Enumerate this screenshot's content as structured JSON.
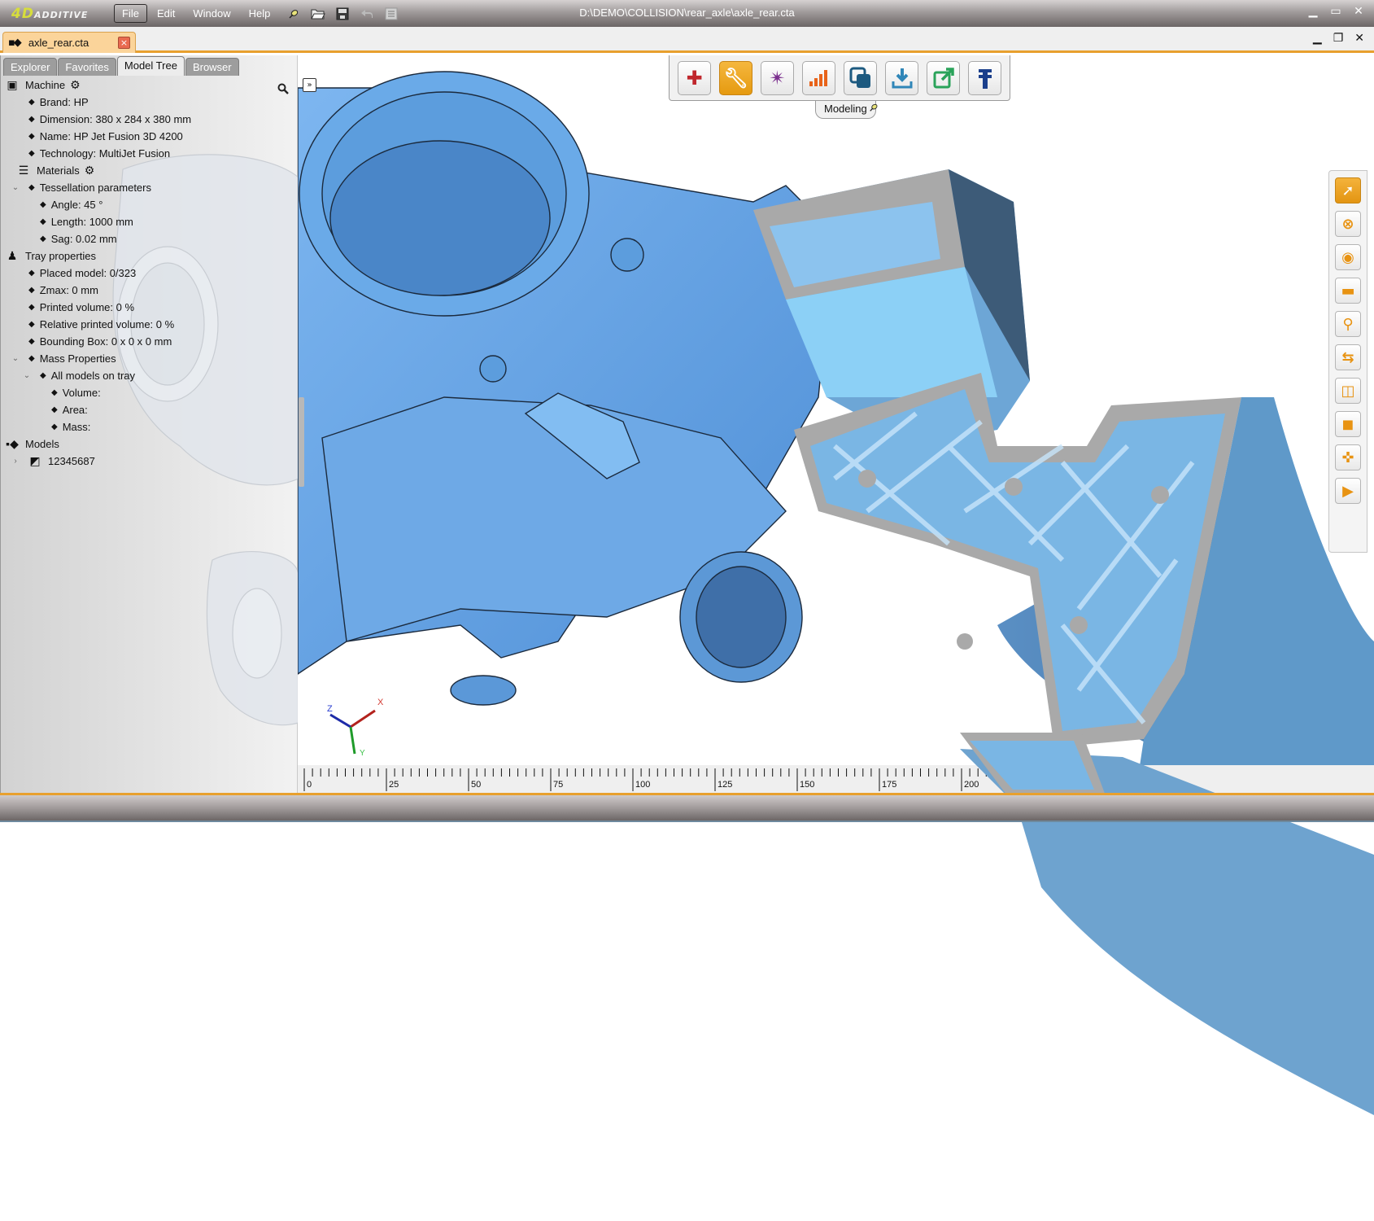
{
  "app": {
    "logo_primary": "4D",
    "logo_secondary": "ADDITIVE",
    "title": "D:\\DEMO\\COLLISION\\rear_axle\\axle_rear.cta",
    "menu": [
      {
        "label": "File",
        "active": true
      },
      {
        "label": "Edit"
      },
      {
        "label": "Window"
      },
      {
        "label": "Help"
      }
    ],
    "quick_icons": [
      "pin-icon",
      "open-folder-icon",
      "save-icon",
      "undo-icon",
      "list-icon"
    ],
    "window_controls": [
      "minimize",
      "maximize",
      "close"
    ]
  },
  "document": {
    "tab_label": "axle_rear.cta",
    "tab_close": "×",
    "controls": [
      "minimize",
      "restore",
      "close"
    ]
  },
  "panel": {
    "tabs": [
      {
        "label": "Explorer"
      },
      {
        "label": "Favorites"
      },
      {
        "label": "Model Tree",
        "active": true
      },
      {
        "label": "Browser"
      }
    ],
    "tree": [
      {
        "label": "Machine",
        "level": 0,
        "icon": "machine-icon",
        "gear": true
      },
      {
        "label": "Brand: HP",
        "level": 1,
        "icon": "bullet"
      },
      {
        "label": "Dimension: 380 x 284 x 380 mm",
        "level": 1,
        "icon": "bullet"
      },
      {
        "label": "Name: HP Jet Fusion 3D 4200",
        "level": 1,
        "icon": "bullet"
      },
      {
        "label": "Technology: MultiJet Fusion",
        "level": 1,
        "icon": "bullet"
      },
      {
        "label": "Materials",
        "level": 1,
        "icon": "database-icon",
        "gear": true
      },
      {
        "label": "Tessellation parameters",
        "level": 1,
        "icon": "bullet",
        "expanded": true
      },
      {
        "label": "Angle: 45 °",
        "level": 2,
        "icon": "bullet"
      },
      {
        "label": "Length: 1000 mm",
        "level": 2,
        "icon": "bullet"
      },
      {
        "label": "Sag: 0.02 mm",
        "level": 2,
        "icon": "bullet"
      },
      {
        "label": "Tray properties",
        "level": 0,
        "icon": "tray-icon"
      },
      {
        "label": "Placed model: 0/323",
        "level": 1,
        "icon": "bullet"
      },
      {
        "label": "Zmax: 0 mm",
        "level": 1,
        "icon": "bullet"
      },
      {
        "label": "Printed volume: 0 %",
        "level": 1,
        "icon": "bullet"
      },
      {
        "label": "Relative printed volume: 0 %",
        "level": 1,
        "icon": "bullet"
      },
      {
        "label": "Bounding Box: 0 x 0 x 0 mm",
        "level": 1,
        "icon": "bullet"
      },
      {
        "label": "Mass Properties",
        "level": 1,
        "icon": "bullet",
        "expanded": true
      },
      {
        "label": "All models on tray",
        "level": 2,
        "icon": "bullet",
        "expanded": true
      },
      {
        "label": "Volume:",
        "level": 3,
        "icon": "bullet"
      },
      {
        "label": "Area:",
        "level": 3,
        "icon": "bullet"
      },
      {
        "label": "Mass:",
        "level": 3,
        "icon": "bullet"
      },
      {
        "label": "Models",
        "level": 0,
        "icon": "models-icon"
      },
      {
        "label": "12345687",
        "level": 1,
        "icon": "model-hidden-icon",
        "collapsed": true
      }
    ]
  },
  "toolbar": {
    "label": "Modeling",
    "buttons": [
      {
        "name": "add-button",
        "icon": "plus-icon",
        "color": "#c0272d"
      },
      {
        "name": "repair-button",
        "icon": "wrench-icon",
        "color": "#ffffff",
        "active": true
      },
      {
        "name": "star-button",
        "icon": "compass-star-icon",
        "color": "#7b2f8e"
      },
      {
        "name": "signal-button",
        "icon": "bars-icon",
        "color": "#e8631a"
      },
      {
        "name": "copy-button",
        "icon": "copy-icon",
        "color": "#1d5a80"
      },
      {
        "name": "download-button",
        "icon": "download-icon",
        "color": "#2f86b8"
      },
      {
        "name": "export-button",
        "icon": "export-icon",
        "color": "#2aa35a"
      },
      {
        "name": "measure-button",
        "icon": "caliper-icon",
        "color": "#1b3f8c"
      }
    ]
  },
  "right_toolbar": [
    {
      "name": "select-tool",
      "icon": "cursor-icon",
      "active": true
    },
    {
      "name": "cancel-tool",
      "icon": "cancel-circle-icon"
    },
    {
      "name": "ring-tool",
      "icon": "ring-icon"
    },
    {
      "name": "frame-tool",
      "icon": "frame-icon"
    },
    {
      "name": "inspect-tool",
      "icon": "inspect-icon"
    },
    {
      "name": "swap-tool",
      "icon": "swap-arrows-icon"
    },
    {
      "name": "split-tool",
      "icon": "split-view-icon"
    },
    {
      "name": "corner-tool",
      "icon": "rounded-corner-icon"
    },
    {
      "name": "grid-tool",
      "icon": "grid-cross-icon"
    },
    {
      "name": "more-tool",
      "icon": "partial-icon"
    }
  ],
  "axes": {
    "x": "X",
    "y": "Y",
    "z": "Z"
  },
  "ruler": {
    "labels": [
      "0",
      "25",
      "50",
      "75",
      "100",
      "125",
      "150",
      "175",
      "200"
    ]
  },
  "viewport": {
    "collapse_label": "»"
  },
  "colors": {
    "accent": "#e8a02e",
    "model_blue": "#6aa8e8",
    "lattice_blue": "#7fb8e6",
    "section_gray": "#a8a8a8"
  }
}
